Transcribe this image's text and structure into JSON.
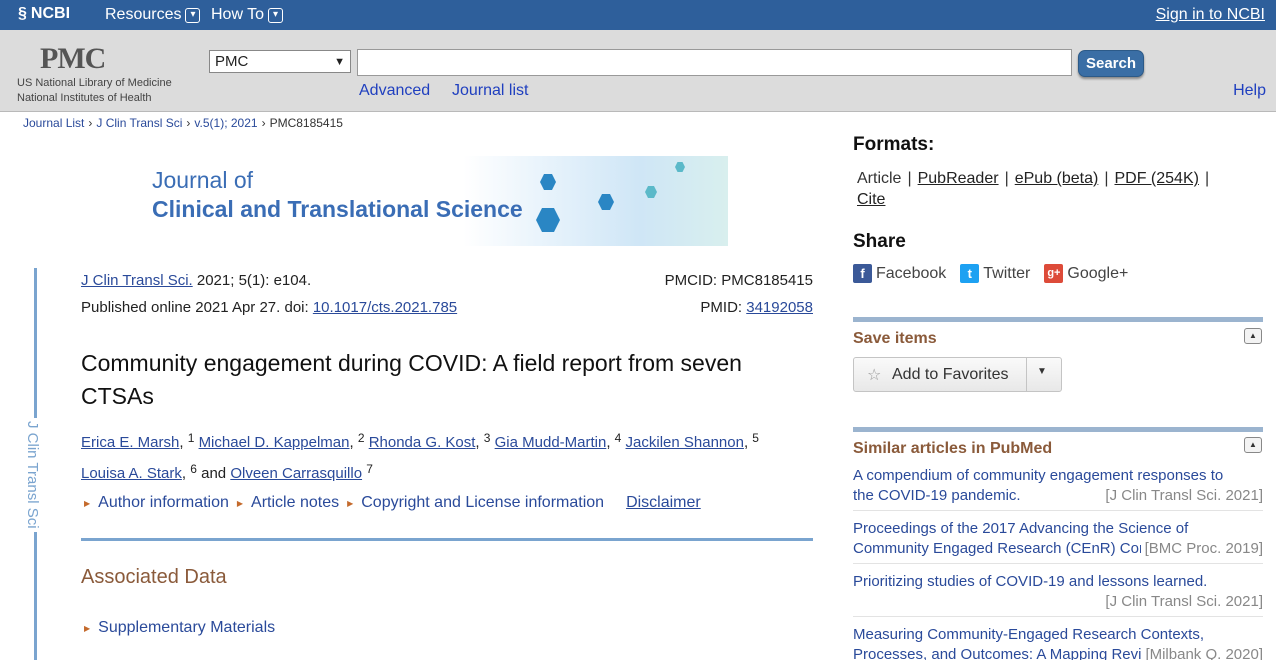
{
  "ncbi": {
    "logo": "NCBI",
    "menu_resources": "Resources",
    "menu_howto": "How To",
    "signin": "Sign in to NCBI"
  },
  "pmc": {
    "logo": "PMC",
    "sub1": "US National Library of Medicine",
    "sub2": "National Institutes of Health",
    "db_selected": "PMC",
    "search_value": "",
    "search_button": "Search",
    "advanced": "Advanced",
    "journal_list": "Journal list",
    "help": "Help"
  },
  "breadcrumb": {
    "items": [
      "Journal List",
      "J Clin Transl Sci",
      "v.5(1); 2021"
    ],
    "current": "PMC8185415",
    "sep": "›"
  },
  "banner": {
    "line1": "Journal of",
    "line2": "Clinical and Translational Science"
  },
  "vertical_label": "J Clin Transl Sci",
  "citation": {
    "journal_link": "J Clin Transl Sci.",
    "journal_rest": " 2021; 5(1): e104.",
    "published": "Published online 2021 Apr 27. doi: ",
    "doi": "10.1017/cts.2021.785",
    "pmcid_label": "PMCID: ",
    "pmcid": "PMC8185415",
    "pmid_label": "PMID: ",
    "pmid": "34192058"
  },
  "article": {
    "title": "Community engagement during COVID: A field report from seven CTSAs",
    "authors": [
      {
        "name": "Erica E. Marsh",
        "aff": "1"
      },
      {
        "name": "Michael D. Kappelman",
        "aff": "2"
      },
      {
        "name": "Rhonda G. Kost",
        "aff": "3"
      },
      {
        "name": "Gia Mudd-Martin",
        "aff": "4"
      },
      {
        "name": "Jackilen Shannon",
        "aff": "5"
      },
      {
        "name": "Louisa A. Stark",
        "aff": "6"
      },
      {
        "name": "Olveen Carrasquillo",
        "aff": "7"
      }
    ],
    "and": "and",
    "info_links": [
      "Author information",
      "Article notes",
      "Copyright and License information"
    ],
    "disclaimer": "Disclaimer",
    "associated_data": "Associated Data",
    "supplementary": "Supplementary Materials"
  },
  "sidebar": {
    "formats_heading": "Formats:",
    "formats_current": "Article",
    "formats": [
      "PubReader",
      "ePub (beta)",
      "PDF (254K)",
      "Cite"
    ],
    "share_heading": "Share",
    "share": [
      {
        "label": "Facebook",
        "icon": "facebook-icon",
        "glyph": "f",
        "color": "#3b5998"
      },
      {
        "label": "Twitter",
        "icon": "twitter-icon",
        "glyph": "t",
        "color": "#1da1f2"
      },
      {
        "label": "Google+",
        "icon": "google-plus-icon",
        "glyph": "g+",
        "color": "#dd4b39"
      }
    ],
    "save_heading": "Save items",
    "add_favorites": "Add to Favorites",
    "similar_heading": "Similar articles in PubMed",
    "similar": [
      {
        "line1": "A compendium of community engagement responses to",
        "line2": "the COVID-19 pandemic.",
        "source": "[J Clin Transl Sci. 2021]"
      },
      {
        "line1": "Proceedings of the 2017 Advancing the Science of",
        "line2": "Community Engaged Research (CEnR) Conference",
        "source": "[BMC Proc. 2019]"
      },
      {
        "line1": "Prioritizing studies of COVID-19 and lessons learned.",
        "line2": "",
        "source": "[J Clin Transl Sci. 2021]"
      },
      {
        "line1": "Measuring Community-Engaged Research Contexts,",
        "line2": "Processes, and Outcomes: A Mapping Review",
        "source": "[Milbank Q. 2020]"
      }
    ]
  }
}
